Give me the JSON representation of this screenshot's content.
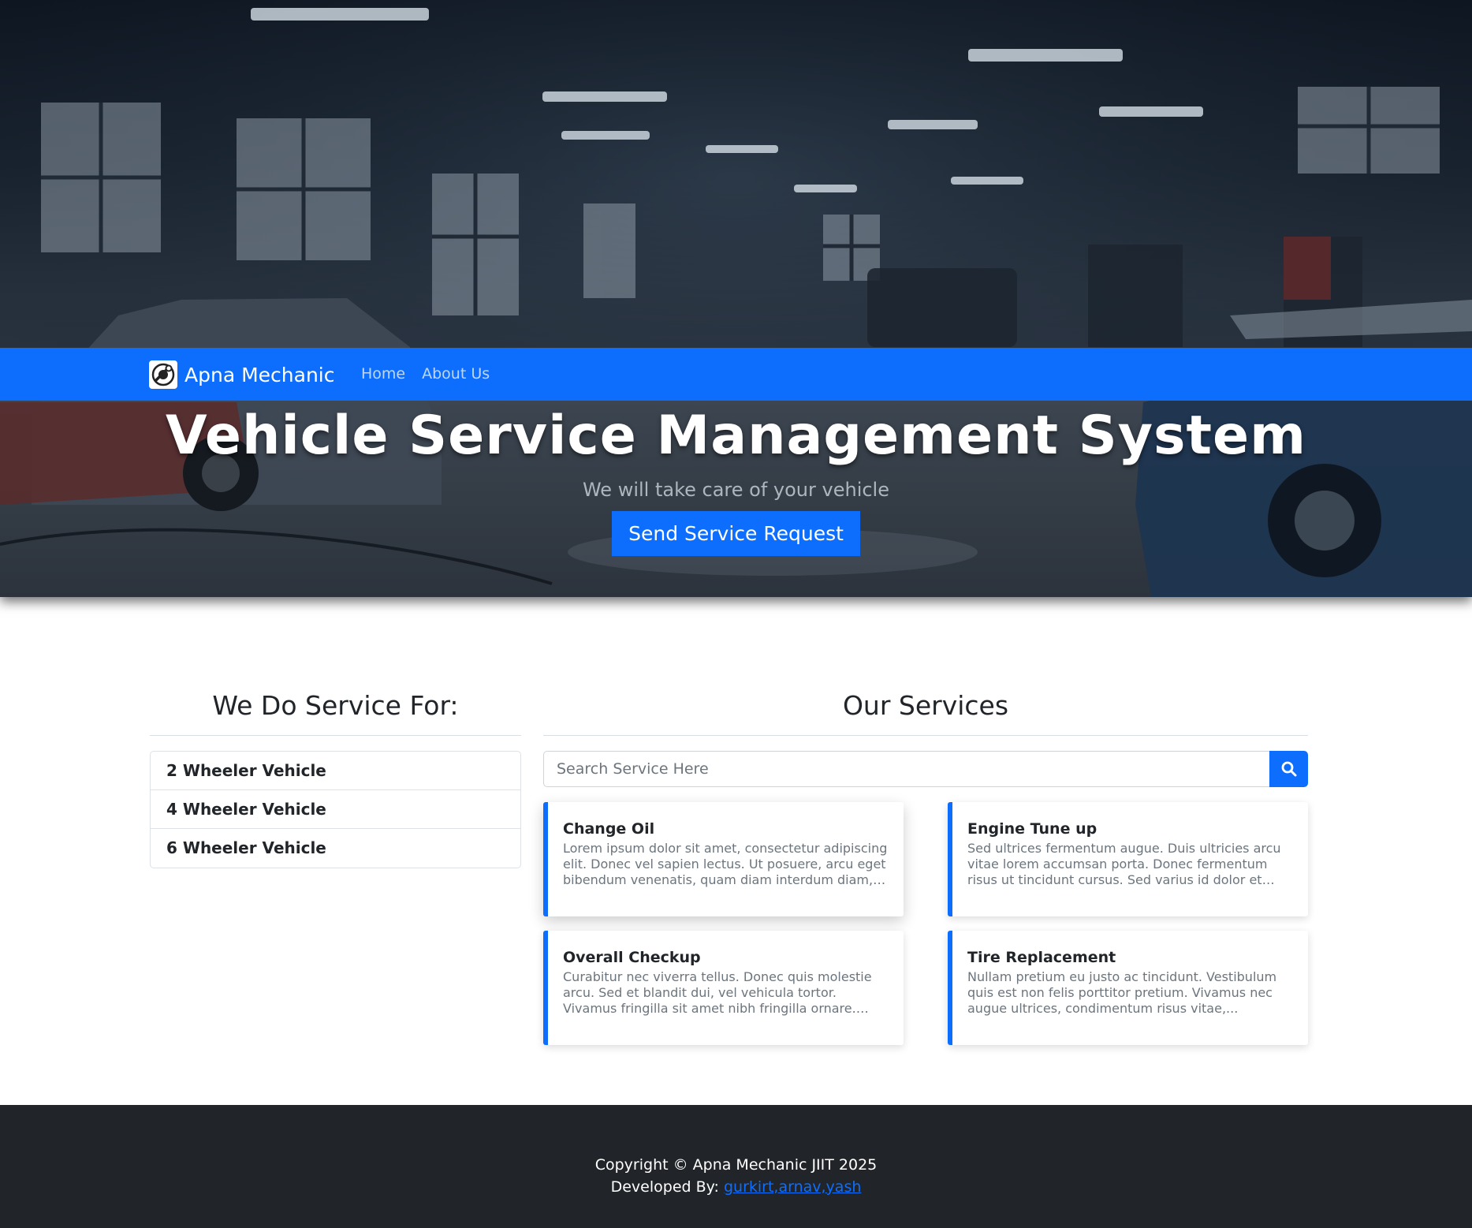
{
  "navbar": {
    "brand": "Apna Mechanic",
    "links": [
      "Home",
      "About Us"
    ]
  },
  "hero": {
    "title": "Vehicle Service Management System",
    "subtitle": "We will take care of your vehicle",
    "cta_label": "Send Service Request"
  },
  "vehicles": {
    "heading": "We Do Service For:",
    "items": [
      "2 Wheeler Vehicle",
      "4 Wheeler Vehicle",
      "6 Wheeler Vehicle"
    ]
  },
  "services": {
    "heading": "Our Services",
    "search_placeholder": "Search Service Here",
    "cards": [
      {
        "title": "Change Oil",
        "description": "Lorem ipsum dolor sit amet, consectetur adipiscing elit. Donec vel sapien lectus. Ut posuere, arcu eget bibendum venenatis, quam diam interdum diam, in..."
      },
      {
        "title": "Engine Tune up",
        "description": "Sed ultrices fermentum augue. Duis ultricies arcu vitae lorem accumsan porta. Donec fermentum risus ut tincidunt cursus. Sed varius id dolor et euismod...."
      },
      {
        "title": "Overall Checkup",
        "description": "Curabitur nec viverra tellus. Donec quis molestie arcu. Sed et blandit dui, vel vehicula tortor. Vivamus fringilla sit amet nibh fringilla ornare. Etiam iaculi..."
      },
      {
        "title": "Tire Replacement",
        "description": "Nullam pretium eu justo ac tincidunt. Vestibulum quis est non felis porttitor pretium. Vivamus nec augue ultrices, condimentum risus vitae,..."
      }
    ]
  },
  "footer": {
    "copyright": "Copyright © Apna Mechanic JIIT 2025",
    "developed_by_label": "Developed By: ",
    "developers": "gurkirt,arnav,yash"
  },
  "colors": {
    "primary": "#0d6efd",
    "footer_bg": "#212529"
  },
  "icons": {
    "search": "search-icon",
    "brand": "mechanic-logo-icon"
  }
}
